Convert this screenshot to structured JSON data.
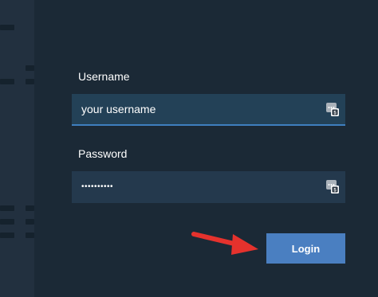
{
  "form": {
    "username": {
      "label": "Username",
      "placeholder": "your username"
    },
    "password": {
      "label": "Password",
      "value": "••••••••••"
    },
    "login_label": "Login"
  },
  "colors": {
    "background": "#1b2936",
    "field": "#24394d",
    "focus_border": "#3f7fbf",
    "button": "#4a7fc1",
    "arrow": "#e5322d"
  },
  "icons": {
    "password_manager": "password-manager-icon",
    "annotation": "red-arrow"
  }
}
